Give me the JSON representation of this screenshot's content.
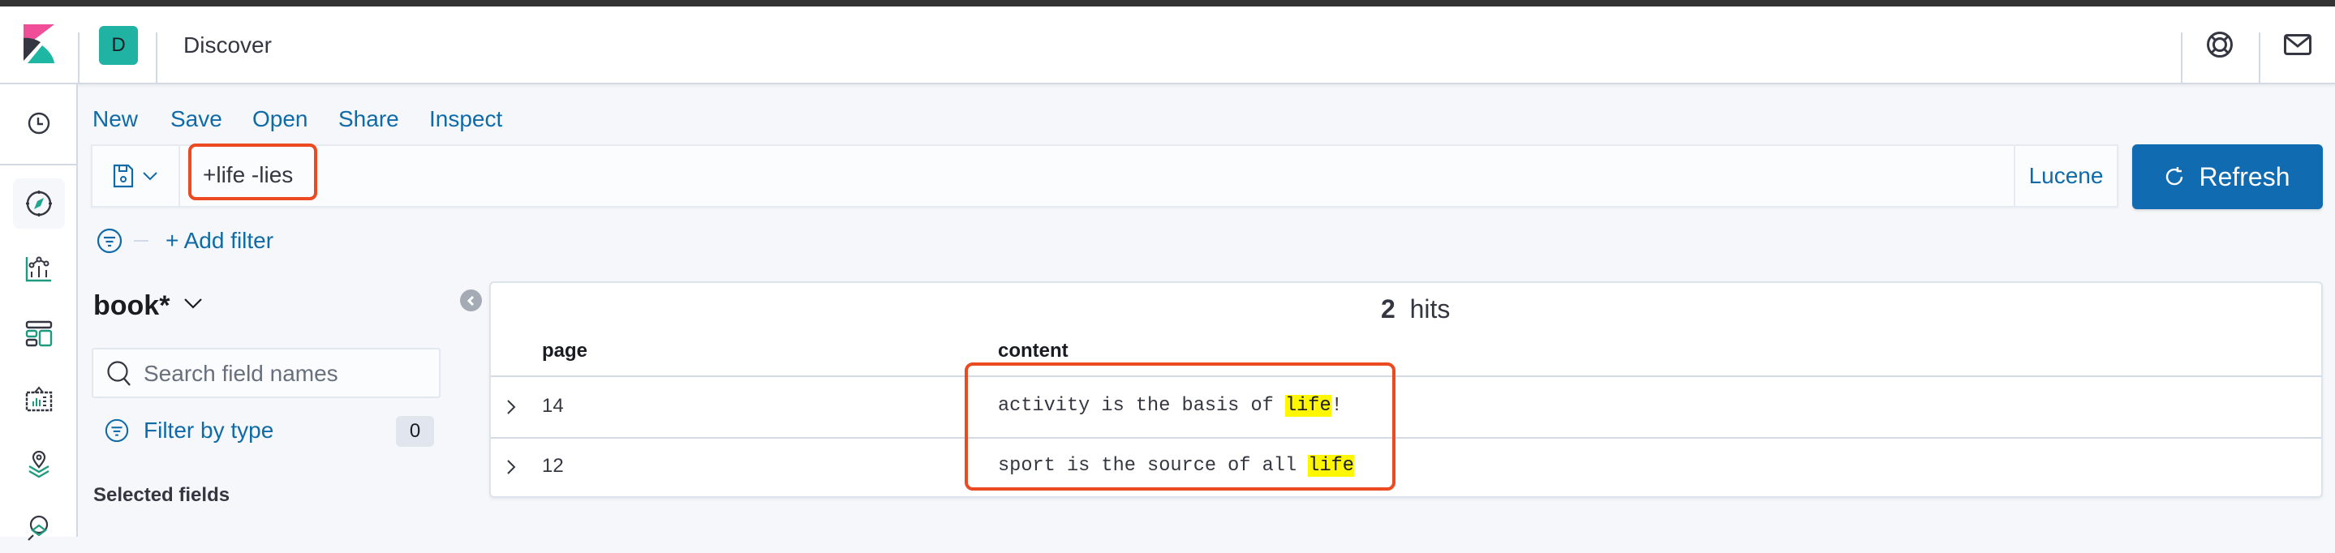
{
  "header": {
    "app_logo": "kibana-logo",
    "space_avatar_letter": "D",
    "title": "Discover",
    "icons": [
      "help-icon",
      "newsfeed-mail-icon"
    ]
  },
  "sidebar": {
    "items": [
      {
        "name": "recently-viewed",
        "icon": "clock-icon",
        "active": false
      },
      {
        "name": "discover",
        "icon": "compass-icon",
        "active": true
      },
      {
        "name": "visualize",
        "icon": "visualize-icon",
        "active": false
      },
      {
        "name": "dashboard",
        "icon": "dashboard-icon",
        "active": false
      },
      {
        "name": "canvas",
        "icon": "canvas-icon",
        "active": false
      },
      {
        "name": "maps",
        "icon": "maps-icon",
        "active": false
      },
      {
        "name": "machine-learning",
        "icon": "ml-icon",
        "active": false
      }
    ]
  },
  "toolbar": {
    "menu": [
      "New",
      "Save",
      "Open",
      "Share",
      "Inspect"
    ]
  },
  "query": {
    "value": "+life -lies",
    "language": "Lucene",
    "refresh_label": "Refresh"
  },
  "filters": {
    "add_filter_label": "+ Add filter"
  },
  "field_sidebar": {
    "index_pattern": "book*",
    "search_placeholder": "Search field names",
    "filter_by_type_label": "Filter by type",
    "filter_count": "0",
    "selected_fields_label": "Selected fields"
  },
  "results": {
    "hit_count": "2",
    "hits_label": "hits",
    "columns": [
      "page",
      "content"
    ],
    "rows": [
      {
        "page": "14",
        "content_before": "activity is the basis of ",
        "highlight": "life",
        "content_after": "!"
      },
      {
        "page": "12",
        "content_before": "sport is the source of all ",
        "highlight": "life",
        "content_after": ""
      }
    ]
  },
  "annotations": {
    "highlight_color": "#ec4b22"
  },
  "colors": {
    "accent": "#106bb0",
    "link": "#0f6ba8",
    "highlight": "#fff700",
    "avatar": "#20b2a2"
  }
}
